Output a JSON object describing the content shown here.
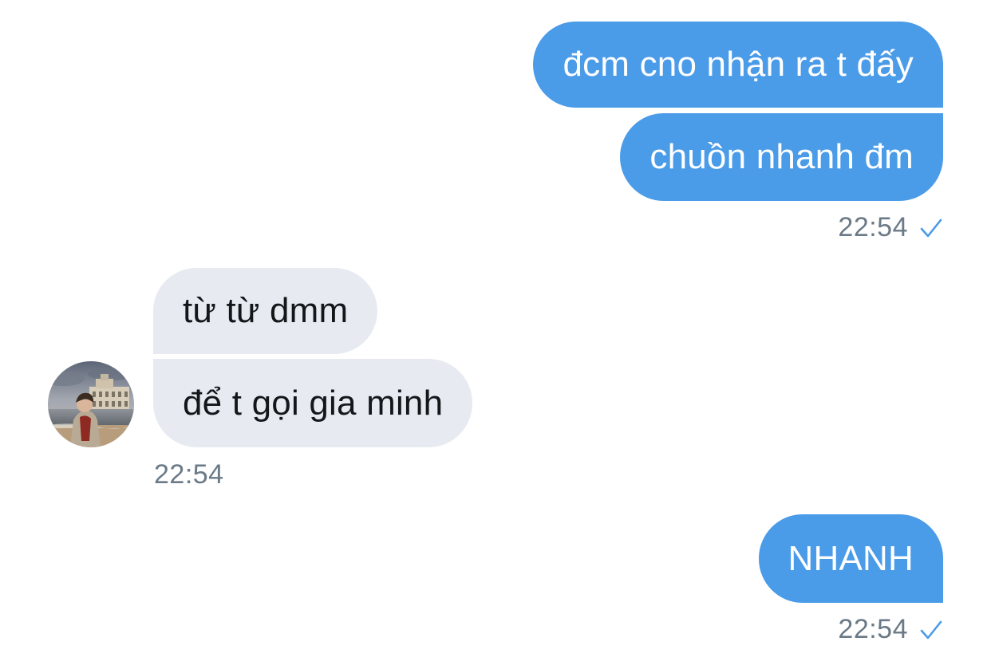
{
  "conversation": {
    "messages": [
      {
        "direction": "outgoing",
        "text": "đcm cno nhận ra t đấy"
      },
      {
        "direction": "outgoing",
        "text": "chuồn nhanh đm"
      },
      {
        "direction": "incoming",
        "text": "từ từ dmm"
      },
      {
        "direction": "incoming",
        "text": "để t gọi gia minh"
      },
      {
        "direction": "outgoing",
        "text": "NHANH"
      }
    ],
    "timestamps": {
      "group1": "22:54",
      "group2": "22:54",
      "group3": "22:54"
    },
    "icons": {
      "sent": "checkmark-icon",
      "avatar": "user-avatar-photo"
    },
    "colors": {
      "outgoing_bubble": "#4a9be8",
      "incoming_bubble": "#e7ebf1",
      "timestamp": "#6b7a87"
    }
  }
}
